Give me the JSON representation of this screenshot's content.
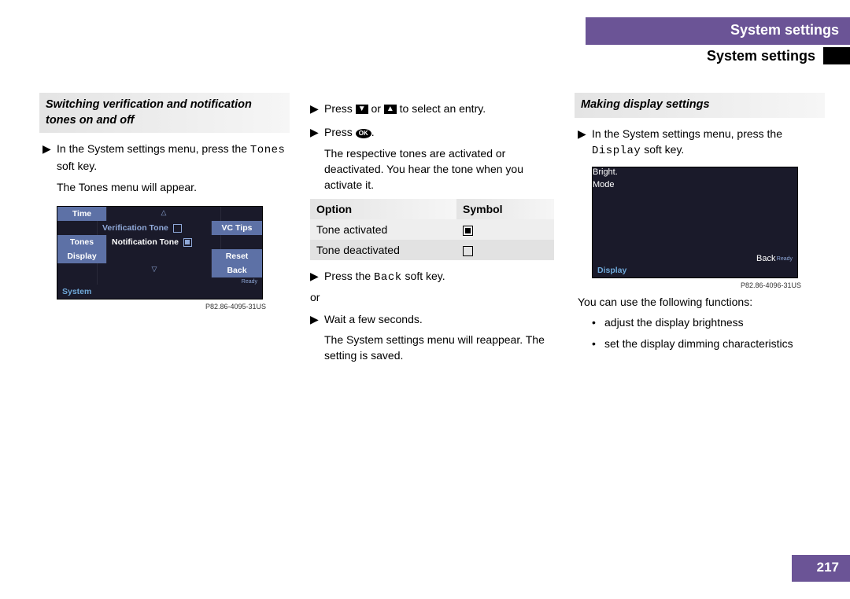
{
  "header": {
    "purpleTab": "System settings",
    "subtitle": "System settings"
  },
  "col1": {
    "sectionHead": "Switching verification and notification tones on and off",
    "s1a": "In the System settings menu, press the ",
    "s1key": "Tones",
    "s1b": " soft key.",
    "s1result": "The Tones menu will appear.",
    "screen": {
      "time": "Time",
      "verif": "Verification Tone",
      "vctips": "VC Tips",
      "tones": "Tones",
      "notif": "Notification Tone",
      "display": "Display",
      "reset": "Reset",
      "back": "Back",
      "system": "System",
      "ready": "Ready"
    },
    "imgcode": "P82.86-4095-31US"
  },
  "col2": {
    "s1a": "Press ",
    "s1b": " or ",
    "s1c": " to select an entry.",
    "s2a": "Press ",
    "s2b": ".",
    "s2res": "The respective tones are activated or deactivated. You hear the tone when you activate it.",
    "tbl": {
      "h1": "Option",
      "h2": "Symbol",
      "r1": "Tone activated",
      "r2": "Tone deactivated"
    },
    "s3a": "Press the ",
    "s3key": "Back",
    "s3b": " soft key.",
    "or": "or",
    "s4": "Wait a few seconds.",
    "s4res": "The System settings menu will reappear. The setting is saved."
  },
  "col3": {
    "sectionHead": "Making display settings",
    "s1a": "In the System settings menu, press the ",
    "s1key": "Display",
    "s1b": " soft key.",
    "screen": {
      "bright": "Bright.",
      "mode": "Mode",
      "back": "Back",
      "display": "Display",
      "ready": "Ready"
    },
    "imgcode": "P82.86-4096-31US",
    "after": "You can use the following functions:",
    "b1": "adjust the display brightness",
    "b2": "set the display dimming characteristics"
  },
  "pageNum": "217"
}
